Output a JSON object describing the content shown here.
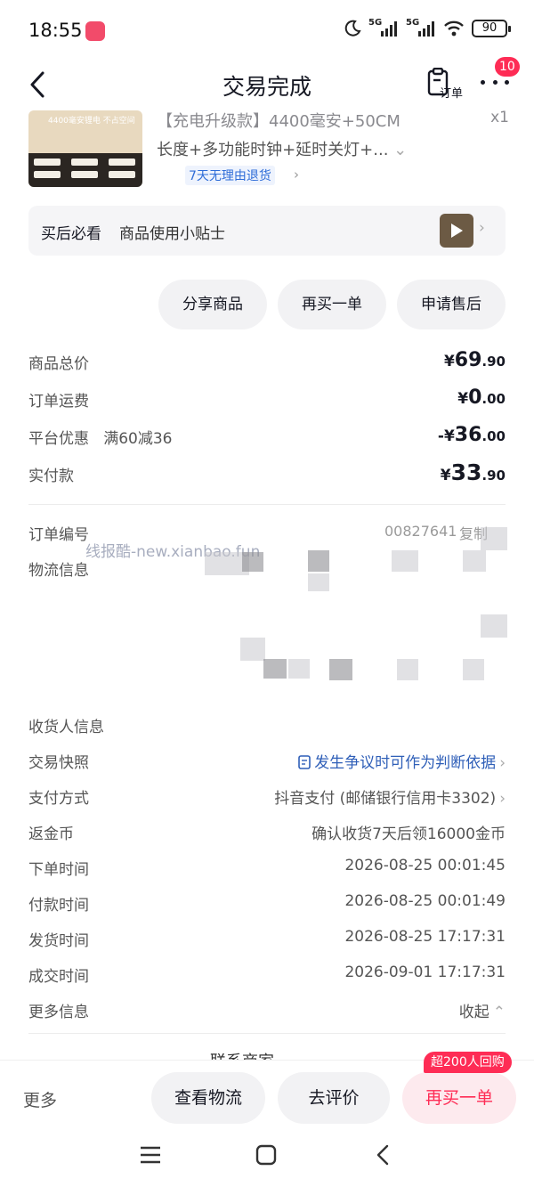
{
  "status_bar": {
    "time": "18:55",
    "battery": "90",
    "net1": "5G",
    "net2": "5G"
  },
  "nav": {
    "title": "交易完成",
    "order_label": "订单",
    "badge": "10"
  },
  "product": {
    "title_line1": "【充电升级款】4400毫安+50CM",
    "title_line2": "长度+多功能时钟+延时关灯+...",
    "quantity": "x1",
    "tag": "7天无理由退货",
    "thumb_text": "4400毫安锂电 不占空间"
  },
  "tips": {
    "title": "买后必看",
    "text": "商品使用小贴士"
  },
  "actions": {
    "share": "分享商品",
    "rebuy": "再买一单",
    "after_sale": "申请售后"
  },
  "prices": {
    "total_label": "商品总价",
    "total_symbol": "¥",
    "total_int": "69",
    "total_dec": ".90",
    "shipping_label": "订单运费",
    "shipping_symbol": "¥",
    "shipping_int": "0",
    "shipping_dec": ".00",
    "discount_label": "平台优惠",
    "discount_rule": "满60减36",
    "discount_symbol": "-¥",
    "discount_int": "36",
    "discount_dec": ".00",
    "paid_label": "实付款",
    "paid_symbol": "¥",
    "paid_int": "33",
    "paid_dec": ".90"
  },
  "order_info": {
    "order_no_label": "订单编号",
    "order_no_partial": "00827641",
    "copy": "复制",
    "logistics_label": "物流信息",
    "watermark": "线报酷-new.xianbao.fun",
    "receiver_label": "收货人信息",
    "snapshot_label": "交易快照",
    "snapshot_value": "发生争议时可作为判断依据",
    "pay_label": "支付方式",
    "pay_value": "抖音支付 (邮储银行信用卡3302)",
    "coins_label": "返金币",
    "coins_value": "确认收货7天后领16000金币",
    "order_time_label": "下单时间",
    "order_time": "2026-08-25 00:01:45",
    "pay_time_label": "付款时间",
    "pay_time": "2026-08-25 00:01:49",
    "ship_time_label": "发货时间",
    "ship_time": "2026-08-25 17:17:31",
    "deal_time_label": "成交时间",
    "deal_time": "2026-09-01 17:17:31",
    "more_info_label": "更多信息",
    "collapse": "收起"
  },
  "contact_peek": "联系商家",
  "bottom_bar": {
    "more": "更多",
    "view_logistics": "查看物流",
    "review": "去评价",
    "rebuy": "再买一单",
    "rebuy_tag": "超200人回购"
  },
  "colors": {
    "accent": "#fe2c55",
    "link": "#2f5fb8",
    "tag_blue": "#2f6dd8"
  }
}
